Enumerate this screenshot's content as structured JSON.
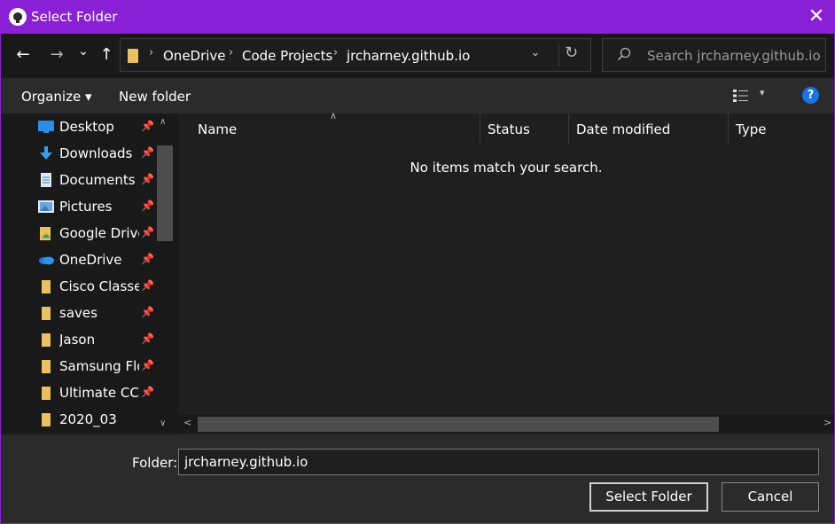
{
  "window": {
    "title": "Select Folder",
    "close_glyph": "✕",
    "accent_color": "#8a20d6"
  },
  "nav": {
    "back_glyph": "←",
    "forward_glyph": "→",
    "recent_glyph": "⌄",
    "up_glyph": "↑",
    "breadcrumb": [
      "OneDrive",
      "Code Projects",
      "jrcharney.github.io"
    ],
    "sep_glyph": "›",
    "dropdown_glyph": "⌄",
    "refresh_glyph": "↻"
  },
  "search": {
    "placeholder": "Search jrcharney.github.io"
  },
  "toolbar": {
    "organize_label": "Organize ▾",
    "new_folder_label": "New folder",
    "view_dropdown_glyph": "▾",
    "help_glyph": "?"
  },
  "sidebar": {
    "items": [
      {
        "label": "Desktop",
        "icon": "desktop-icon",
        "pinned": true
      },
      {
        "label": "Downloads",
        "icon": "downloads-icon",
        "pinned": true
      },
      {
        "label": "Documents",
        "icon": "documents-icon",
        "pinned": true
      },
      {
        "label": "Pictures",
        "icon": "pictures-icon",
        "pinned": true
      },
      {
        "label": "Google Drive",
        "icon": "google-drive-icon",
        "pinned": true
      },
      {
        "label": "OneDrive",
        "icon": "onedrive-icon",
        "pinned": true
      },
      {
        "label": "Cisco Classes",
        "icon": "folder-icon",
        "pinned": true
      },
      {
        "label": "saves",
        "icon": "folder-icon",
        "pinned": true
      },
      {
        "label": "Jason",
        "icon": "folder-icon",
        "pinned": true
      },
      {
        "label": "Samsung Flow",
        "icon": "folder-icon",
        "pinned": true
      },
      {
        "label": "Ultimate CCNA",
        "icon": "folder-icon",
        "pinned": true
      },
      {
        "label": "2020_03",
        "icon": "folder-icon",
        "pinned": false
      }
    ],
    "pin_glyph": "📌"
  },
  "filelist": {
    "columns": [
      "Name",
      "Status",
      "Date modified",
      "Type"
    ],
    "empty_message": "No items match your search."
  },
  "footer": {
    "folder_label": "Folder:",
    "folder_value": "jrcharney.github.io",
    "select_button": "Select Folder",
    "cancel_button": "Cancel"
  }
}
